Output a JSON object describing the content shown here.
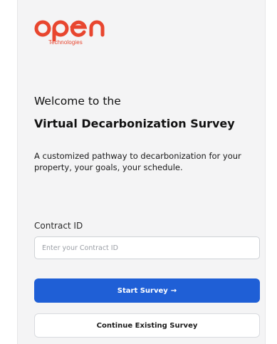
{
  "brand": {
    "logo_text": "open",
    "subtitle": "Technologies",
    "accent_color": "#e8462f"
  },
  "heading": {
    "welcome": "Welcome to the",
    "title": "Virtual Decarbonization Survey"
  },
  "description": "A customized pathway to decarbonization for your property, your goals, your schedule.",
  "contract": {
    "label": "Contract ID",
    "placeholder": "Enter your Contract ID",
    "value": ""
  },
  "buttons": {
    "start_label": "Start Survey",
    "start_icon": "arrow-right-icon",
    "start_color": "#1f5fd6",
    "continue_label": "Continue Existing Survey"
  }
}
